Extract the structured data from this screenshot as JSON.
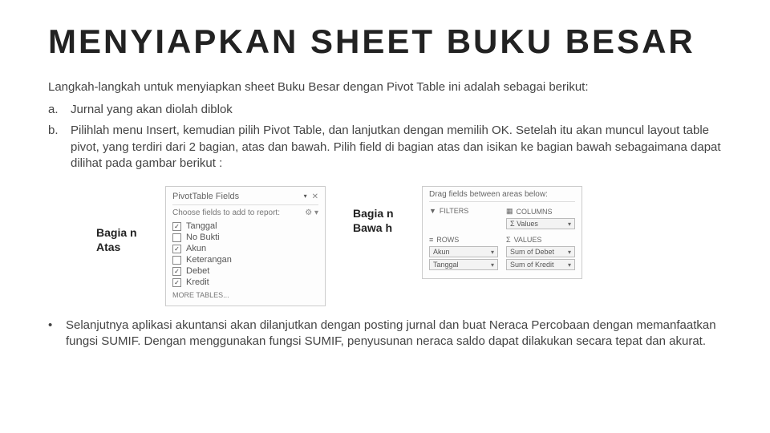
{
  "title": "MENYIAPKAN SHEET BUKU BESAR",
  "intro": "Langkah-langkah untuk menyiapkan sheet Buku Besar dengan Pivot Table ini adalah sebagai berikut:",
  "steps": {
    "a": {
      "marker": "a.",
      "text": "Jurnal yang akan diolah diblok"
    },
    "b": {
      "marker": "b.",
      "text": "Pilihlah menu Insert, kemudian pilih Pivot Table, dan lanjutkan dengan memilih OK. Setelah itu akan muncul layout table pivot, yang terdiri dari 2 bagian, atas dan bawah. Pilih field di bagian atas dan isikan ke bagian bawah sebagaimana dapat dilihat pada gambar berikut :"
    }
  },
  "labels": {
    "atas": "Bagia n Atas",
    "bawah": "Bagia n Bawa h"
  },
  "pivotFields": {
    "header": "PivotTable Fields",
    "sub": "Choose fields to add to report:",
    "fields": [
      {
        "name": "Tanggal",
        "checked": true
      },
      {
        "name": "No Bukti",
        "checked": false
      },
      {
        "name": "Akun",
        "checked": true
      },
      {
        "name": "Keterangan",
        "checked": false
      },
      {
        "name": "Debet",
        "checked": true
      },
      {
        "name": "Kredit",
        "checked": true
      }
    ],
    "more": "MORE TABLES..."
  },
  "areas": {
    "top": "Drag fields between areas below:",
    "filters": {
      "title": "FILTERS",
      "items": []
    },
    "columns": {
      "title": "COLUMNS",
      "items": [
        "Σ Values"
      ]
    },
    "rows": {
      "title": "ROWS",
      "items": [
        "Akun",
        "Tanggal"
      ]
    },
    "values": {
      "title": "VALUES",
      "items": [
        "Sum of Debet",
        "Sum of Kredit"
      ]
    }
  },
  "footer": "Selanjutnya aplikasi akuntansi akan dilanjutkan dengan posting jurnal dan buat Neraca Percobaan dengan memanfaatkan fungsi SUMIF. Dengan menggunakan fungsi SUMIF, penyusunan neraca saldo dapat dilakukan secara tepat dan akurat."
}
